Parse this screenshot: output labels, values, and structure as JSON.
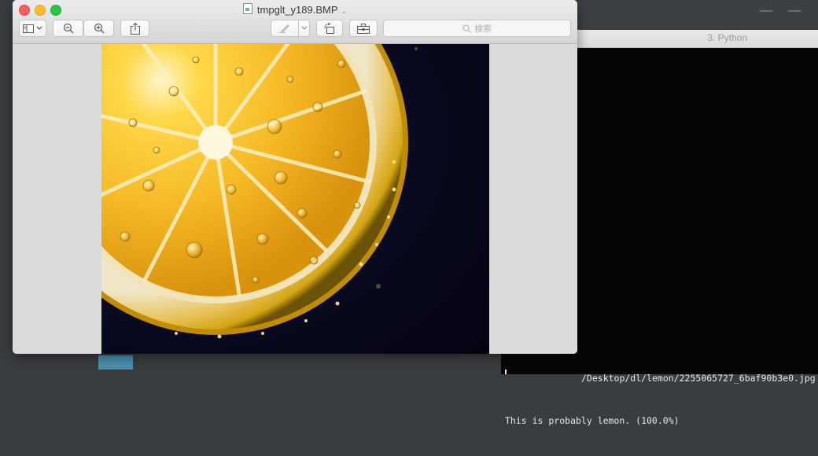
{
  "preview": {
    "title": "tmpglt_y189.BMP",
    "search_placeholder": "検索",
    "toolbar": {
      "sidebar_icon": "sidebar-icon",
      "zoom_out_icon": "zoom-out-icon",
      "zoom_in_icon": "zoom-in-icon",
      "share_icon": "share-icon",
      "markup_icon": "pen-icon",
      "rotate_icon": "rotate-icon",
      "toolbox_icon": "toolbox-icon"
    },
    "image_description_icon": "lemon-slice-photo"
  },
  "terminal": {
    "title": "3. Python",
    "lines": [
      "/Desktop/dl/lemon/2255065727_6baf90b3e0.jpg",
      "This is probably lemon. (100.0%)"
    ]
  },
  "colors": {
    "close": "#fc5f57",
    "minimize": "#fdbc2e",
    "zoom": "#29c840",
    "terminal_bg": "#050505"
  }
}
